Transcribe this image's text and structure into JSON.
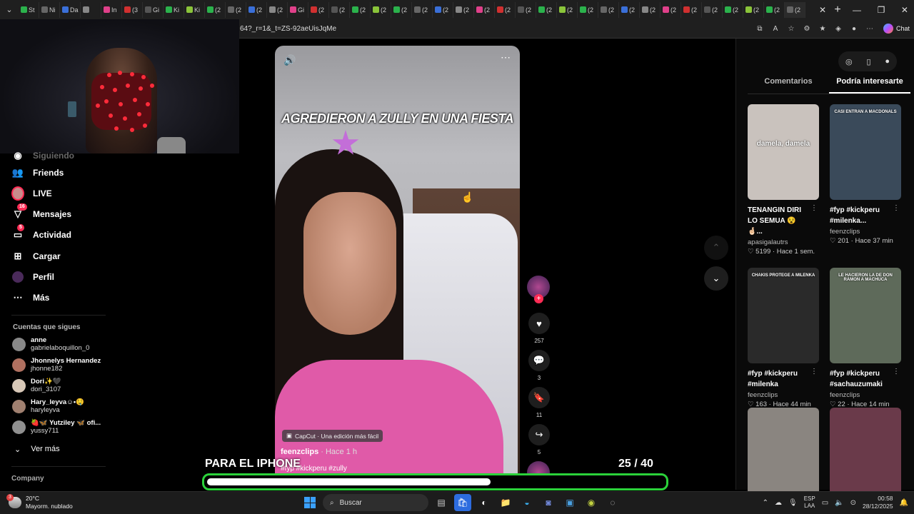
{
  "browser": {
    "tabs": [
      "St",
      "Ni",
      "Da",
      "",
      "In",
      "(3",
      "Gi",
      "Ki",
      "Ki",
      "(2",
      "(2",
      "(2",
      "(2",
      "Gi",
      "(2",
      "(2",
      "(2",
      "(2",
      "(2",
      "(2",
      "(2",
      "(2",
      "(2",
      "(2",
      "(2",
      "(2",
      "(2",
      "(2",
      "(2",
      "(2",
      "(2",
      "(2",
      "(2",
      "(2",
      "(2",
      "(2",
      "(2",
      "(2"
    ],
    "url": "64?_r=1&_t=ZS-92aeUisJqMe",
    "chat_label": "Chat"
  },
  "sidebar": {
    "partial_item": "Siguiendo",
    "items": [
      {
        "label": "Friends",
        "icon": "friends-icon"
      },
      {
        "label": "LIVE",
        "icon": "live-avatar"
      },
      {
        "label": "Mensajes",
        "icon": "messages-icon",
        "badge": "16"
      },
      {
        "label": "Actividad",
        "icon": "activity-icon",
        "badge": "5"
      },
      {
        "label": "Cargar",
        "icon": "upload-icon"
      },
      {
        "label": "Perfil",
        "icon": "profile-icon"
      },
      {
        "label": "Más",
        "icon": "more-icon"
      }
    ],
    "following_title": "Cuentas que sigues",
    "following": [
      {
        "name": "anne",
        "handle": "gabrielaboquillon_0"
      },
      {
        "name": "Jhonnelys Hernandez",
        "handle": "jhonne182"
      },
      {
        "name": "Dori✨🖤",
        "handle": "dori_3107"
      },
      {
        "name": "Hary_leyva☺︎•🤤",
        "handle": "haryleyva"
      },
      {
        "name": "🍓🦋 Yutziley 🦋 ofi...",
        "handle": "yussy711"
      }
    ],
    "see_more": "Ver más",
    "company": "Company"
  },
  "video": {
    "caption": "AGREDIERON A ZULLY EN UNA FIESTA",
    "capcut": "CapCut · Una edición más fácil",
    "author": "feenzclips",
    "time": "· Hace 1 h",
    "tags": "#fyp #kickperu #zully",
    "likes": "257",
    "comments": "3",
    "saves": "11",
    "shares": "5"
  },
  "overlay": {
    "text": "PARA EL IPHONE",
    "count": "25   / 40",
    "progress": 0.62
  },
  "right_panel": {
    "tabs": [
      "Comentarios",
      "Podría interesarte"
    ],
    "active_tab": 1,
    "cards": [
      {
        "overlay": "damela, damela",
        "title": "TENANGIN DIRI LO SEMUA 😵 🤞🏻...",
        "author": "apasigalautrs",
        "meta": "♡ 5199 · Hace 1 sem.",
        "bg": "#c9c2bd"
      },
      {
        "overlay": "CASI ENTRAN A MACDONALS",
        "title": "#fyp #kickperu #milenka...",
        "author": "feenzclips",
        "meta": "♡ 201 · Hace 37 min",
        "bg": "#3a4a5a"
      },
      {
        "overlay": "CHAKIS PROTEGE A MILENKA",
        "title": "#fyp #kickperu #milenka",
        "author": "feenzclips",
        "meta": "♡ 163 · Hace 44 min",
        "bg": "#2a2a2a"
      },
      {
        "overlay": "LE HACIERON LA DE DON RAMON A MACHUCA",
        "title": "#fyp #kickperu #sachauzumaki",
        "author": "feenzclips",
        "meta": "♡ 22 · Hace 14 min",
        "bg": "#5e6a5a"
      },
      {
        "overlay": "",
        "title": "",
        "author": "",
        "meta": "",
        "bg": "#8a8580"
      },
      {
        "overlay": "",
        "title": "",
        "author": "",
        "meta": "",
        "bg": "#6a3a4a"
      }
    ]
  },
  "taskbar": {
    "temp": "20°C",
    "weather": "Mayorm. nublado",
    "search": "Buscar",
    "lang1": "ESP",
    "lang2": "LAA",
    "time": "00:58",
    "date": "28/12/2025"
  }
}
